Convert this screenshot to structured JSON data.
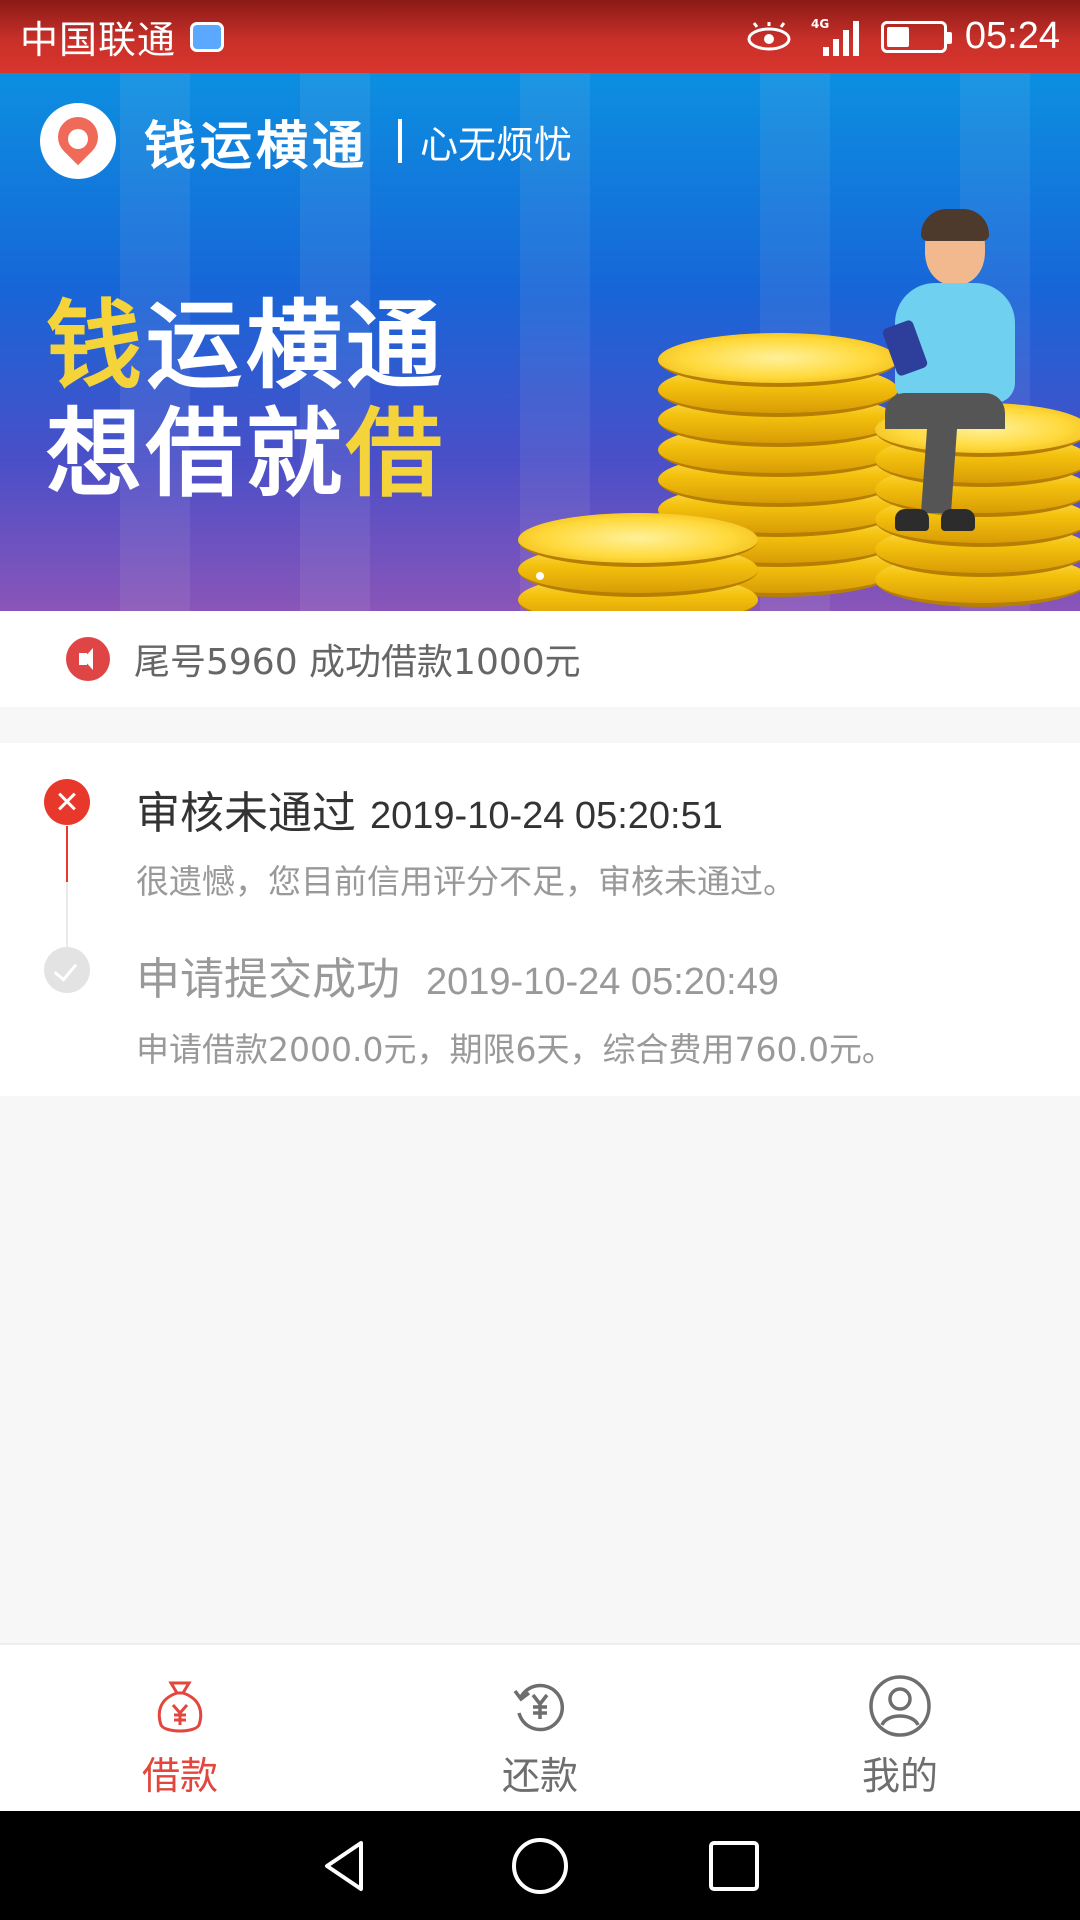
{
  "status_bar": {
    "carrier": "中国联通",
    "network": "4G LTE",
    "time": "05:24"
  },
  "banner": {
    "brand": "钱运横通",
    "slogan": "心无烦忧",
    "headline_line1_yellow": "钱",
    "headline_line1_white": "运横通",
    "headline_line2_white": "想借就",
    "headline_line2_yellow": "借"
  },
  "notice": {
    "text": "尾号5960 成功借款1000元"
  },
  "timeline": {
    "items": [
      {
        "title": "审核未通过",
        "time": "2019-10-24 05:20:51",
        "desc": "很遗憾，您目前信用评分不足，审核未通过。",
        "status": "failed"
      },
      {
        "title": "申请提交成功",
        "time": "2019-10-24 05:20:49",
        "desc": "申请借款2000.0元，期限6天，综合费用760.0元。",
        "status": "done"
      }
    ]
  },
  "bottom_nav": {
    "items": [
      {
        "label": "借款",
        "icon": "money-bag-icon",
        "active": true
      },
      {
        "label": "还款",
        "icon": "repay-icon",
        "active": false
      },
      {
        "label": "我的",
        "icon": "profile-icon",
        "active": false
      }
    ]
  },
  "colors": {
    "accent": "#e2463c",
    "status_bar": "#d8352c",
    "fail": "#e8382c",
    "muted": "#999999"
  }
}
